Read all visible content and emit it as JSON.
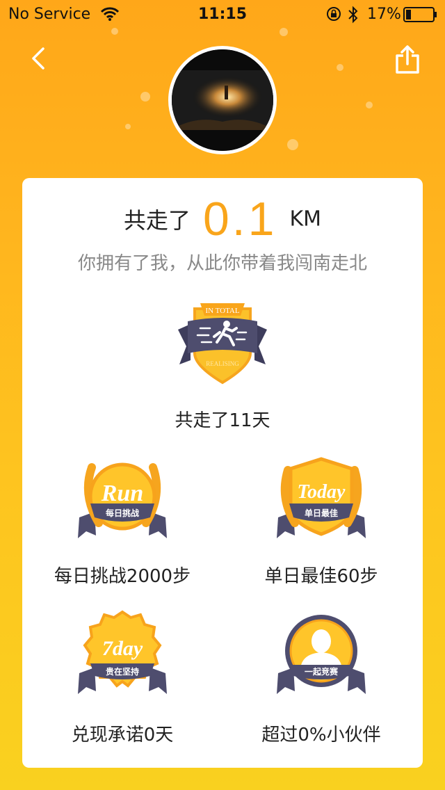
{
  "status_bar": {
    "carrier": "No Service",
    "time": "11:15",
    "battery": "17%"
  },
  "summary": {
    "prefix": "共走了",
    "value": "0.1",
    "unit": "KM",
    "subtitle": "你拥有了我，从此你带着我闯南走北"
  },
  "badges": {
    "total": {
      "label": "共走了11天",
      "ribbon_text": "IN TOTAL",
      "bottom_text": "REALISING"
    },
    "daily_challenge": {
      "label": "每日挑战2000步",
      "title": "Run",
      "subtitle": "每日挑战"
    },
    "daily_best": {
      "label": "单日最佳60步",
      "title": "Today",
      "subtitle": "单日最佳"
    },
    "promise": {
      "label": "兑现承诺0天",
      "title": "7day",
      "subtitle": "贵在坚持"
    },
    "compete": {
      "label": "超过0%小伙伴",
      "subtitle": "一起竞赛"
    }
  },
  "colors": {
    "accent": "#F9A51B",
    "ribbon": "#4E4D6E",
    "gold": "#FFC21F"
  }
}
